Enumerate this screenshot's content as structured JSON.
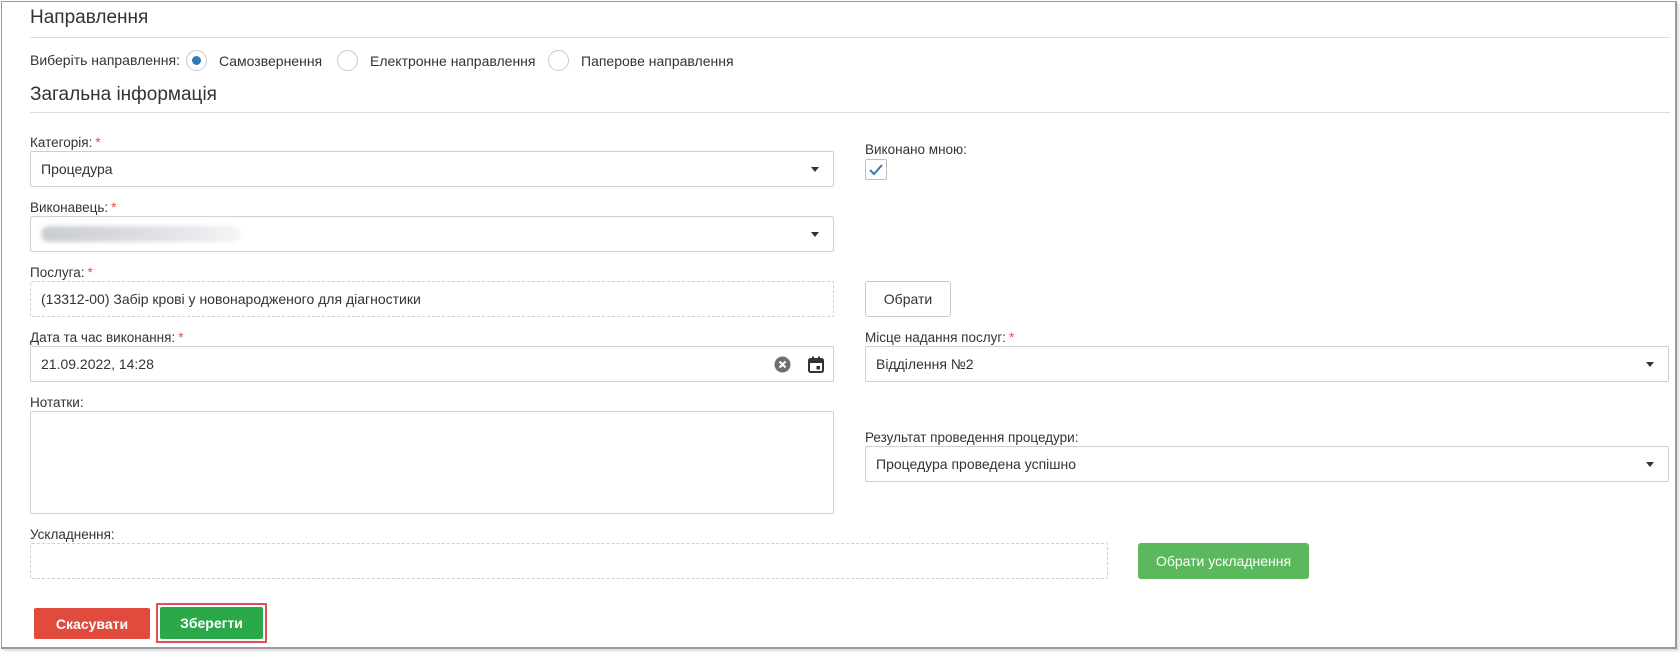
{
  "referral": {
    "section_title": "Направлення",
    "choose_label": "Виберіть направлення:",
    "options": [
      {
        "label": "Самозвернення",
        "selected": true
      },
      {
        "label": "Електронне направлення",
        "selected": false
      },
      {
        "label": "Паперове направлення",
        "selected": false
      }
    ]
  },
  "general": {
    "section_title": "Загальна інформація",
    "category": {
      "label": "Категорія:",
      "value": "Процедура",
      "required": "*"
    },
    "performed_by_me": {
      "label": "Виконано мною:",
      "checked": true
    },
    "performer": {
      "label": "Виконавець:",
      "value": "",
      "required": "*"
    },
    "service": {
      "label": "Послуга:",
      "value": "(13312-00) Забір крові у новонародженого для діагностики",
      "required": "*",
      "choose_button": "Обрати"
    },
    "datetime": {
      "label": "Дата та час виконання:",
      "value": "21.09.2022, 14:28",
      "required": "*"
    },
    "place": {
      "label": "Місце надання послуг:",
      "value": "Відділення №2",
      "required": "*"
    },
    "notes": {
      "label": "Нотатки:",
      "value": ""
    },
    "result": {
      "label": "Результат проведення процедури:",
      "value": "Процедура проведена успішно"
    },
    "complications": {
      "label": "Ускладнення:",
      "value": "",
      "choose_button": "Обрати ускладнення"
    }
  },
  "actions": {
    "cancel": "Скасувати",
    "save": "Зберегти"
  },
  "colors": {
    "accent_blue": "#337ab7",
    "success_green": "#5cb85c",
    "save_green": "#2aa84a",
    "danger_red": "#e04b3d",
    "required_red": "#d9534f"
  },
  "icons": {
    "clear": "clear-circle-icon",
    "calendar": "calendar-icon",
    "dropdown": "chevron-down-icon",
    "check": "check-icon"
  }
}
